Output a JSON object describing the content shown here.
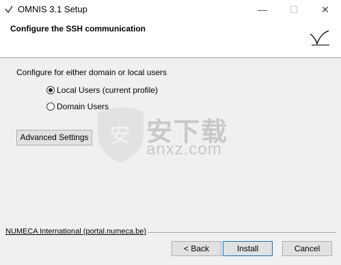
{
  "window": {
    "title": "OMNIS 3.1 Setup",
    "controls": {
      "minimize": "—",
      "maximize": "☐",
      "close": "✕"
    },
    "icon": "app-check-icon"
  },
  "header": {
    "title": "Configure the SSH communication",
    "logo": "numeca-logo-icon"
  },
  "main": {
    "description": "Configure for either domain or local users",
    "options": [
      {
        "label": "Local Users (current profile)",
        "selected": true
      },
      {
        "label": "Domain Users",
        "selected": false
      }
    ],
    "advanced_button": "Advanced Settings"
  },
  "watermark": {
    "text": "安下载",
    "subtext": "anxz.com"
  },
  "footer": {
    "link": "NUMECA International (portal.numeca.be)",
    "back_button": "< Back",
    "install_button": "Install",
    "cancel_button": "Cancel"
  },
  "colors": {
    "window_bg": "#f0f0f0",
    "header_bg": "#ffffff",
    "button_bg": "#e1e1e1",
    "default_button_border": "#0078d7"
  }
}
